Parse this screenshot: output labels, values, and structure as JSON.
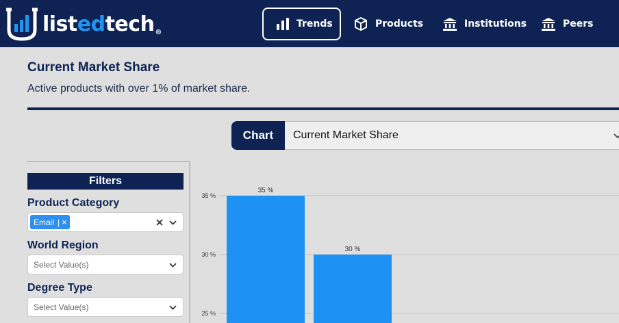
{
  "brand": {
    "logo_part1": "list",
    "logo_part2": "ed",
    "logo_part3": "tech",
    "logo_reg": "®"
  },
  "nav": {
    "items": [
      {
        "label": "Trends",
        "icon": "bar-chart-icon",
        "active": true
      },
      {
        "label": "Products",
        "icon": "cube-icon",
        "active": false
      },
      {
        "label": "Institutions",
        "icon": "institution-icon",
        "active": false
      },
      {
        "label": "Peers",
        "icon": "institution-icon",
        "active": false
      }
    ]
  },
  "page": {
    "title": "Current Market Share",
    "subtitle": "Active products with over 1% of market share."
  },
  "chart_selector": {
    "label": "Chart",
    "value": "Current Market Share"
  },
  "filters": {
    "heading": "Filters",
    "product_category": {
      "label": "Product Category",
      "tag": "Email",
      "tag_separator": "|",
      "tag_remove": "×"
    },
    "world_region": {
      "label": "World Region",
      "placeholder": "Select Value(s)"
    },
    "degree_type": {
      "label": "Degree Type",
      "placeholder": "Select Value(s)"
    }
  },
  "colors": {
    "navy": "#0e2354",
    "bar": "#1e92f4",
    "accent": "#1e95f2"
  },
  "chart_data": {
    "type": "bar",
    "values": [
      35,
      30
    ],
    "data_labels": [
      "35 %",
      "30 %"
    ],
    "yticks": [
      25,
      30,
      35
    ],
    "ytick_labels": [
      "25 %",
      "30 %",
      "35 %"
    ],
    "ylim_visible": [
      25,
      35
    ],
    "grid": true,
    "color": "#1e92f4"
  }
}
